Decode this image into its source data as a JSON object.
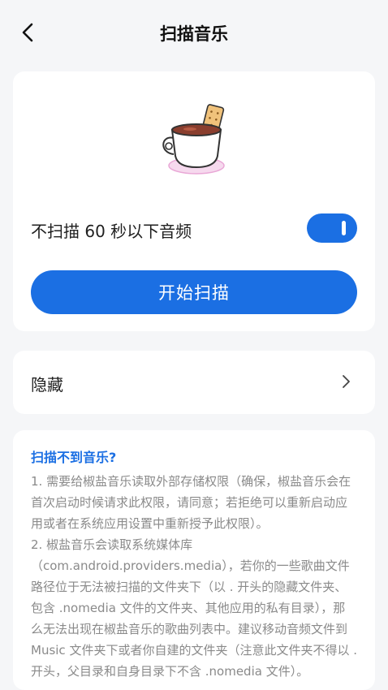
{
  "header": {
    "title": "扫描音乐",
    "back_icon": "chevron-left-icon"
  },
  "scan_card": {
    "illustration": "coffee-cup-illustration",
    "toggle_label": "不扫描 60 秒以下音频",
    "toggle_on": true,
    "scan_button_label": "开始扫描"
  },
  "hidden_card": {
    "label": "隐藏",
    "chevron_icon": "chevron-right-icon"
  },
  "help": {
    "title": "扫描不到音乐?",
    "item1": "1. 需要给椒盐音乐读取外部存储权限（确保，椒盐音乐会在首次启动时候请求此权限，请同意；若拒绝可以重新启动应用或者在系统应用设置中重新授予此权限）。",
    "item2": "2. 椒盐音乐会读取系统媒体库（com.android.providers.media），若你的一些歌曲文件路径位于无法被扫描的文件夹下（以 . 开头的隐藏文件夹、包含 .nomedia 文件的文件夹、其他应用的私有目录），那么无法出现在椒盐音乐的歌曲列表中。建议移动音频文件到 Music 文件夹下或者你自建的文件夹（注意此文件夹不得以 . 开头，父目录和自身目录下不含 .nomedia 文件）。"
  },
  "colors": {
    "accent": "#1b6fe3",
    "background": "#f5f6f8",
    "card": "#ffffff"
  }
}
